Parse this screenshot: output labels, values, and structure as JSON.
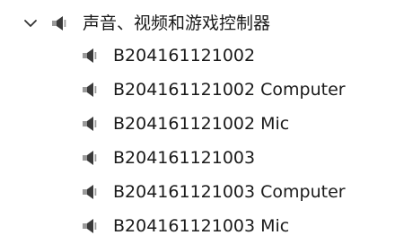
{
  "tree": {
    "category": {
      "label": "声音、视频和游戏控制器",
      "expanded": true,
      "icon": "speaker-icon",
      "expander_icon": "chevron-down-icon"
    },
    "devices": [
      {
        "label": "B204161121002",
        "icon": "speaker-icon"
      },
      {
        "label": "B204161121002 Computer",
        "icon": "speaker-icon"
      },
      {
        "label": "B204161121002 Mic",
        "icon": "speaker-icon"
      },
      {
        "label": "B204161121003",
        "icon": "speaker-icon"
      },
      {
        "label": "B204161121003 Computer",
        "icon": "speaker-icon"
      },
      {
        "label": "B204161121003 Mic",
        "icon": "speaker-icon"
      }
    ]
  },
  "colors": {
    "text": "#1a1a1a",
    "icon_dark": "#3a3a3a",
    "icon_light": "#9a9a9a",
    "chevron": "#333333"
  }
}
